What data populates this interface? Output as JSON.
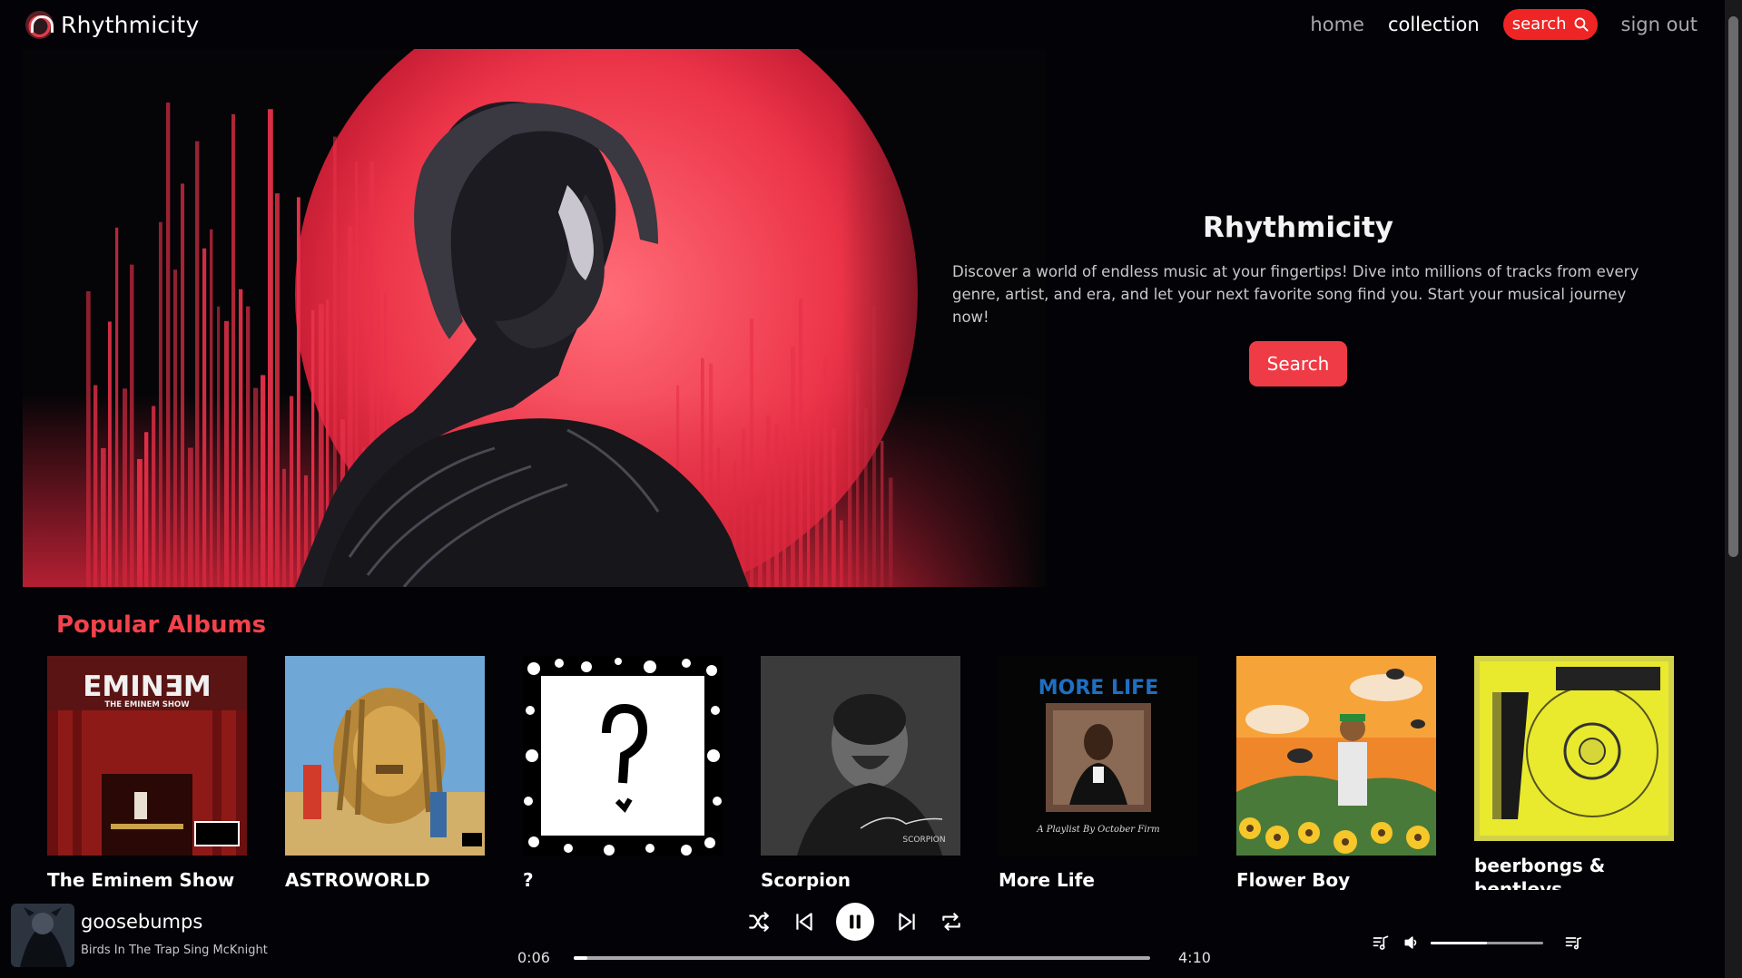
{
  "app": {
    "name": "Rhythmicity"
  },
  "nav": {
    "links": [
      "home",
      "collection"
    ],
    "search_label": "search",
    "signout_label": "sign out"
  },
  "hero": {
    "title": "Rhythmicity",
    "description": "Discover a world of endless music at your fingertips! Dive into millions of tracks from every genre, artist, and era, and let your next favorite song find you. Start your musical journey now!",
    "button_label": "Search"
  },
  "albums_section": {
    "title": "Popular Albums",
    "albums": [
      {
        "title": "The Eminem Show",
        "cover_text": "EMINƎM",
        "cover_sub": "THE EMINEM SHOW"
      },
      {
        "title": "ASTROWORLD"
      },
      {
        "title": "?"
      },
      {
        "title": "Scorpion"
      },
      {
        "title": "More Life",
        "cover_text": "MORE LIFE",
        "cover_sub": "A Playlist By October Firm"
      },
      {
        "title": "Flower Boy"
      },
      {
        "title": "beerbongs & bentleys"
      }
    ]
  },
  "player": {
    "track_title": "goosebumps",
    "album": "Birds In The Trap Sing McKnight",
    "current_time": "0:06",
    "total_time": "4:10",
    "progress": 0.024,
    "volume": 0.5
  },
  "colors": {
    "accent": "#ef2525",
    "section_title": "#f2424b",
    "hero_button": "#ef3b45",
    "background": "#030307"
  },
  "icons": {
    "brand": "headphones-icon",
    "nav_search": "search-icon",
    "shuffle": "shuffle-icon",
    "prev": "skip-previous-icon",
    "play": "pause-icon",
    "next": "skip-next-icon",
    "repeat": "repeat-icon",
    "lyrics": "lyrics-icon",
    "volume": "volume-icon",
    "queue": "queue-icon"
  }
}
